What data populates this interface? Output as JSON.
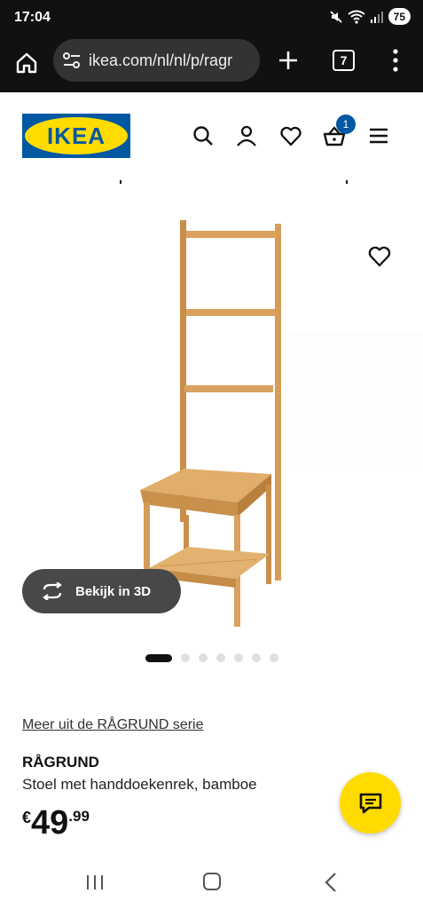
{
  "status": {
    "time": "17:04",
    "battery": "75"
  },
  "browser": {
    "url": "ikea.com/nl/nl/p/ragr",
    "tab_count": "7"
  },
  "header": {
    "logo_text": "IKEA",
    "cart_count": "1"
  },
  "product_view": {
    "view3d_label": "Bekijk in 3D",
    "image_count": 7,
    "active_image": 1
  },
  "product": {
    "series_link": "Meer uit de RÅGRUND serie",
    "name": "RÅGRUND",
    "description": "Stoel met handdoekenrek, bamboe",
    "price_currency": "€",
    "price_integer": "49",
    "price_decimal": ".99"
  },
  "colors": {
    "ikea_blue": "#0058a3",
    "ikea_yellow": "#ffdb00",
    "bamboo": "#d9a25e"
  }
}
